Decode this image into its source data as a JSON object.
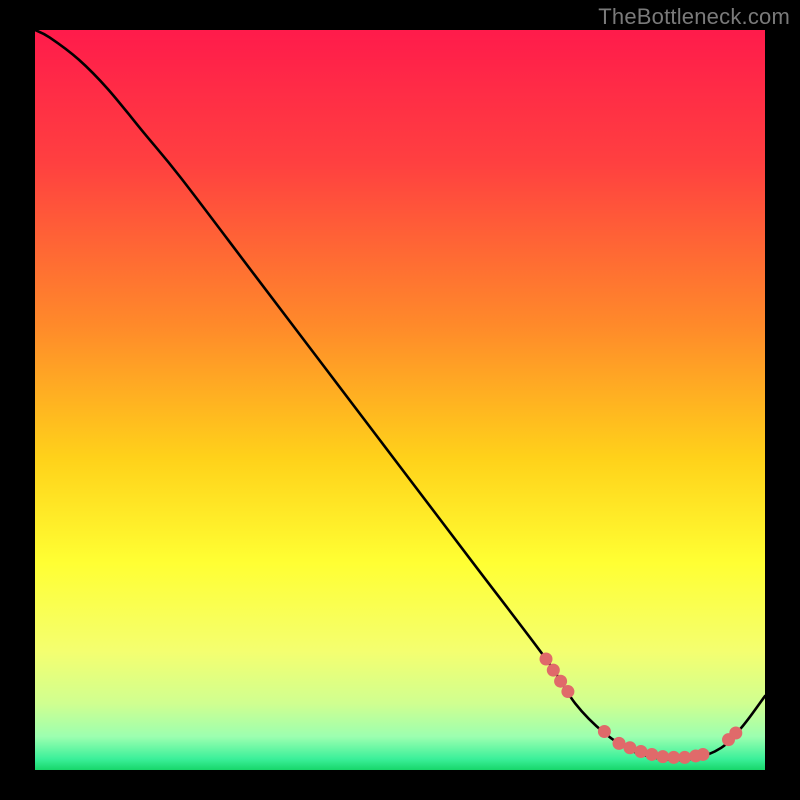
{
  "attribution": "TheBottleneck.com",
  "chart_data": {
    "type": "line",
    "title": "",
    "xlabel": "",
    "ylabel": "",
    "xlim": [
      0,
      100
    ],
    "ylim": [
      0,
      100
    ],
    "grid": false,
    "legend": false,
    "series": [
      {
        "name": "curve",
        "x": [
          0,
          2,
          6,
          10,
          15,
          20,
          30,
          40,
          50,
          60,
          70,
          74,
          78,
          82,
          86,
          90,
          94,
          97,
          100
        ],
        "y": [
          100,
          99,
          96,
          92,
          86,
          80,
          67,
          54,
          41,
          28,
          15,
          9,
          5,
          2.5,
          1.5,
          1.5,
          3,
          6,
          10
        ]
      }
    ],
    "highlight_points": {
      "name": "dots",
      "color": "#e06a6a",
      "x": [
        70,
        71,
        72,
        73,
        78,
        80,
        81.5,
        83,
        84.5,
        86,
        87.5,
        89,
        90.5,
        91.5,
        95,
        96
      ],
      "y": [
        15,
        13.5,
        12,
        10.6,
        5.2,
        3.6,
        3,
        2.5,
        2.1,
        1.8,
        1.7,
        1.7,
        1.9,
        2.1,
        4.1,
        5
      ]
    },
    "background_gradient": {
      "stops": [
        {
          "offset": 0.0,
          "color": "#ff1b4b"
        },
        {
          "offset": 0.18,
          "color": "#ff4040"
        },
        {
          "offset": 0.4,
          "color": "#ff8a2a"
        },
        {
          "offset": 0.58,
          "color": "#ffd21a"
        },
        {
          "offset": 0.72,
          "color": "#ffff33"
        },
        {
          "offset": 0.84,
          "color": "#f4ff70"
        },
        {
          "offset": 0.91,
          "color": "#d0ff90"
        },
        {
          "offset": 0.955,
          "color": "#9cffb0"
        },
        {
          "offset": 0.985,
          "color": "#3bf09a"
        },
        {
          "offset": 1.0,
          "color": "#17d66a"
        }
      ]
    }
  }
}
